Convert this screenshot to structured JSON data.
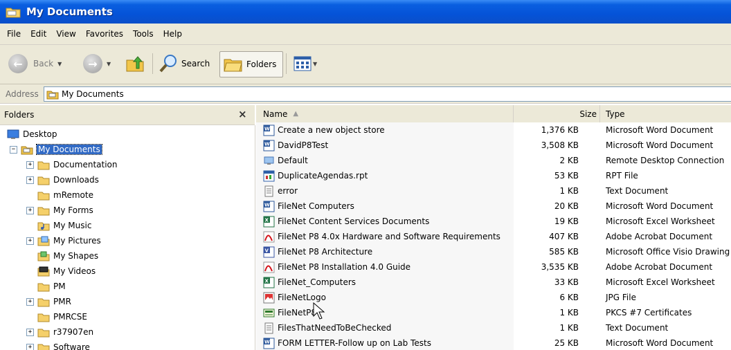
{
  "window": {
    "title": "My Documents"
  },
  "menu": [
    "File",
    "Edit",
    "View",
    "Favorites",
    "Tools",
    "Help"
  ],
  "toolbar": {
    "back_label": "Back",
    "search_label": "Search",
    "folders_label": "Folders"
  },
  "address": {
    "label": "Address",
    "value": "My Documents"
  },
  "folders_pane": {
    "title": "Folders",
    "close": "×"
  },
  "tree": [
    {
      "label": "Desktop",
      "level": 0,
      "icon": "desktop-icon",
      "expander": ""
    },
    {
      "label": "My Documents",
      "level": 1,
      "icon": "open-folder-icon",
      "expander": "−",
      "selected": true
    },
    {
      "label": "Documentation",
      "level": 2,
      "icon": "folder-icon",
      "expander": "+"
    },
    {
      "label": "Downloads",
      "level": 2,
      "icon": "folder-icon",
      "expander": "+"
    },
    {
      "label": "mRemote",
      "level": 2,
      "icon": "folder-icon",
      "expander": ""
    },
    {
      "label": "My Forms",
      "level": 2,
      "icon": "folder-icon",
      "expander": "+"
    },
    {
      "label": "My Music",
      "level": 2,
      "icon": "music-folder-icon",
      "expander": ""
    },
    {
      "label": "My Pictures",
      "level": 2,
      "icon": "pictures-folder-icon",
      "expander": "+"
    },
    {
      "label": "My Shapes",
      "level": 2,
      "icon": "shapes-folder-icon",
      "expander": ""
    },
    {
      "label": "My Videos",
      "level": 2,
      "icon": "videos-folder-icon",
      "expander": ""
    },
    {
      "label": "PM",
      "level": 2,
      "icon": "folder-icon",
      "expander": ""
    },
    {
      "label": "PMR",
      "level": 2,
      "icon": "folder-icon",
      "expander": "+"
    },
    {
      "label": "PMRCSE",
      "level": 2,
      "icon": "folder-icon",
      "expander": ""
    },
    {
      "label": "r37907en",
      "level": 2,
      "icon": "folder-icon",
      "expander": "+"
    },
    {
      "label": "Software",
      "level": 2,
      "icon": "folder-icon",
      "expander": "+"
    }
  ],
  "columns": {
    "name": "Name",
    "size": "Size",
    "type": "Type"
  },
  "files": [
    {
      "name": "Create a new object store",
      "size": "1,376 KB",
      "type": "Microsoft Word Document",
      "icon": "word-icon"
    },
    {
      "name": "DavidP8Test",
      "size": "3,508 KB",
      "type": "Microsoft Word Document",
      "icon": "word-icon"
    },
    {
      "name": "Default",
      "size": "2 KB",
      "type": "Remote Desktop Connection",
      "icon": "remote-desktop-icon"
    },
    {
      "name": "DuplicateAgendas.rpt",
      "size": "53 KB",
      "type": "RPT File",
      "icon": "report-icon"
    },
    {
      "name": "error",
      "size": "1 KB",
      "type": "Text Document",
      "icon": "text-icon"
    },
    {
      "name": "FileNet Computers",
      "size": "20 KB",
      "type": "Microsoft Word Document",
      "icon": "word-icon"
    },
    {
      "name": "FileNet Content Services Documents",
      "size": "19 KB",
      "type": "Microsoft Excel Worksheet",
      "icon": "excel-icon"
    },
    {
      "name": "FileNet P8 4.0x Hardware and Software Requirements",
      "size": "407 KB",
      "type": "Adobe Acrobat Document",
      "icon": "pdf-icon"
    },
    {
      "name": "FileNet P8 Architecture",
      "size": "585 KB",
      "type": "Microsoft Office Visio Drawing",
      "icon": "visio-icon"
    },
    {
      "name": "FileNet P8 Installation 4.0 Guide",
      "size": "3,535 KB",
      "type": "Adobe Acrobat Document",
      "icon": "pdf-icon"
    },
    {
      "name": "FileNet_Computers",
      "size": "33 KB",
      "type": "Microsoft Excel Worksheet",
      "icon": "excel-icon"
    },
    {
      "name": "FileNetLogo",
      "size": "6 KB",
      "type": "JPG File",
      "icon": "jpg-icon"
    },
    {
      "name": "FileNetP8",
      "size": "1 KB",
      "type": "PKCS #7 Certificates",
      "icon": "certificate-icon"
    },
    {
      "name": "FilesThatNeedToBeChecked",
      "size": "1 KB",
      "type": "Text Document",
      "icon": "text-icon"
    },
    {
      "name": "FORM LETTER-Follow up on Lab Tests",
      "size": "25 KB",
      "type": "Microsoft Word Document",
      "icon": "word-icon"
    }
  ]
}
